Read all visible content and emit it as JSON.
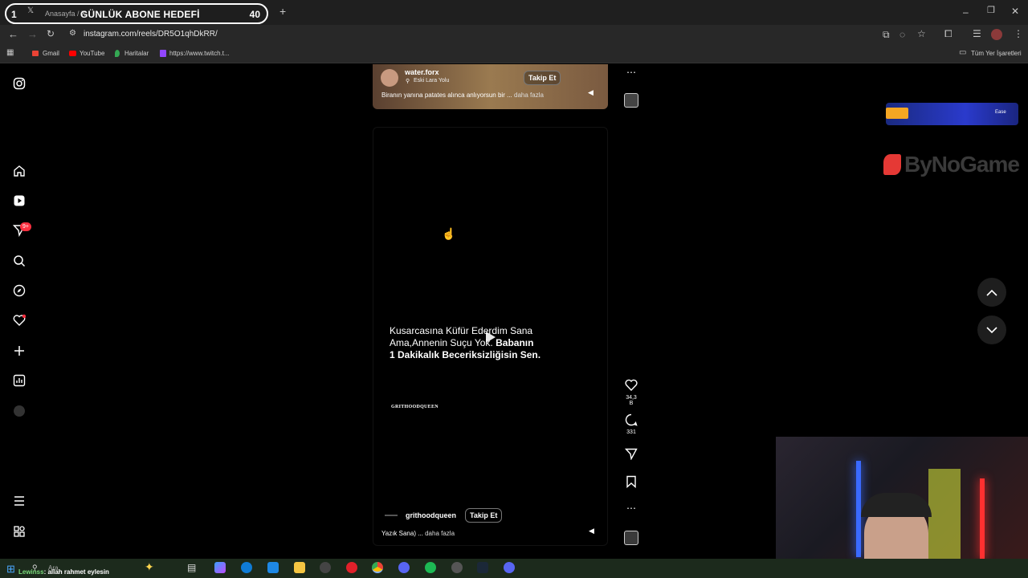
{
  "browser": {
    "tab_ghost": "Anasayfa / X",
    "overlay_goal_index": "1",
    "overlay_goal_label": "GÜNLÜK ABONE HEDEFİ",
    "overlay_goal_count": "40",
    "url": "instagram.com/reels/DR5O1qhDkRR/",
    "bookmarks": [
      "Gmail",
      "YouTube",
      "Haritalar",
      "https://www.twitch.t..."
    ],
    "bookmarks_right": "Tüm Yer İşaretleri"
  },
  "reel_top": {
    "username": "water.forx",
    "location": "Eski Lara Yolu",
    "follow": "Takip Et",
    "caption": "Biranın yanına patates alınca anlıyorsun bir ...",
    "more": "daha fazla"
  },
  "reel_main": {
    "text_line1": "Kusarcasına Küfür Ederdim Sana",
    "text_line2a": "Ama,Annenin Suçu Yok.",
    "text_line2b": "Babanın",
    "text_line3": "1 Dakikalık Beceriksizliğisin Sen.",
    "watermark": "GRITHOODQUEEN",
    "username": "grithoodqueen",
    "follow": "Takip Et",
    "caption": "Yazık Sana) ...",
    "more": "daha fazla"
  },
  "actions": {
    "likes": "34,3 B",
    "comments": "331"
  },
  "overlays": {
    "sponsor": "ByNoGame",
    "badge": "Ease"
  },
  "chat": {
    "user": "Lewinss",
    "message": ": allah rahmet eylesin",
    "search_placeholder": "Ara"
  },
  "notifications": {
    "badge": "9+"
  },
  "colors": {
    "accent_red": "#ff3040",
    "chrome_dark": "#1f1f1f",
    "taskbar": "#1c2a1c"
  }
}
